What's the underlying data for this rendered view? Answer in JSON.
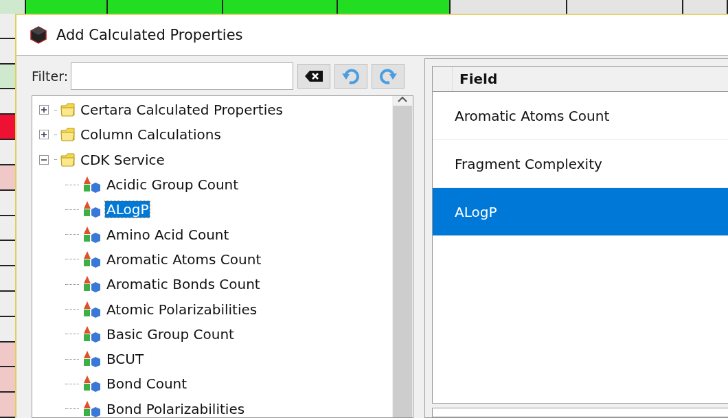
{
  "window": {
    "title": "Add Calculated Properties"
  },
  "filter": {
    "label": "Filter:"
  },
  "tree": [
    {
      "label": "Certara Calculated Properties",
      "expanded": false
    },
    {
      "label": "Column Calculations",
      "expanded": false
    },
    {
      "label": "CDK Service",
      "expanded": true,
      "children": [
        {
          "label": "Acidic Group Count",
          "selected": false
        },
        {
          "label": "ALogP",
          "selected": true
        },
        {
          "label": "Amino Acid Count",
          "selected": false
        },
        {
          "label": "Aromatic Atoms Count",
          "selected": false
        },
        {
          "label": "Aromatic Bonds Count",
          "selected": false
        },
        {
          "label": "Atomic Polarizabilities",
          "selected": false
        },
        {
          "label": "Basic Group Count",
          "selected": false
        },
        {
          "label": "BCUT",
          "selected": false
        },
        {
          "label": "Bond Count",
          "selected": false
        },
        {
          "label": "Bond Polarizabilities",
          "selected": false
        }
      ]
    }
  ],
  "fields_table": {
    "columns": [
      "Field"
    ],
    "rows": [
      {
        "field": "Aromatic Atoms Count",
        "selected": false
      },
      {
        "field": "Fragment Complexity",
        "selected": false
      },
      {
        "field": "ALogP",
        "selected": true
      }
    ]
  }
}
